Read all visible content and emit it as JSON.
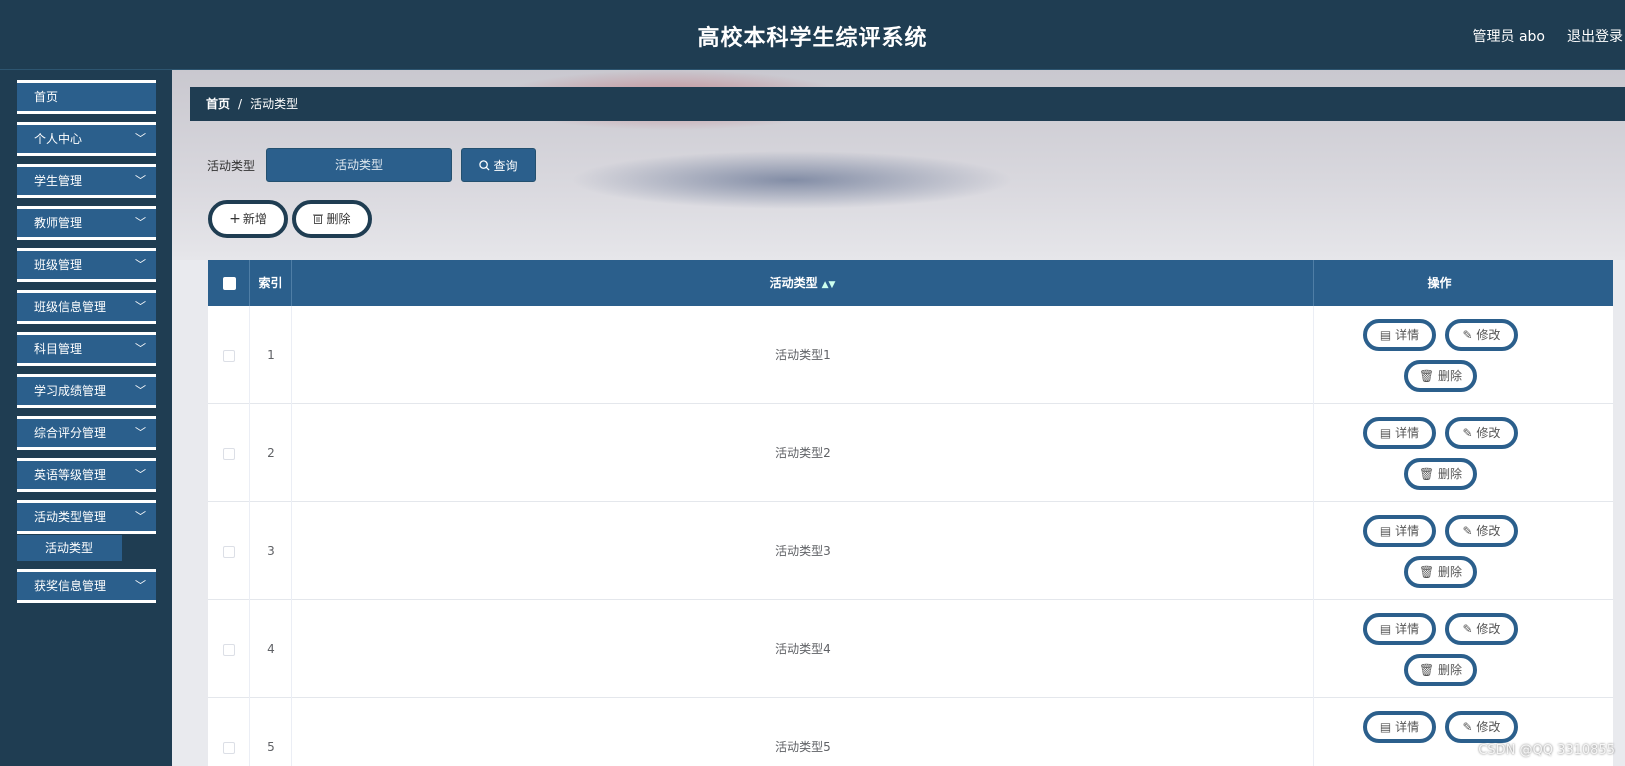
{
  "header": {
    "title": "高校本科学生综评系统",
    "user": "管理员 abo",
    "logout": "退出登录"
  },
  "sidebar": {
    "items": [
      {
        "label": "首页",
        "chevron": false
      },
      {
        "label": "个人中心",
        "chevron": true
      },
      {
        "label": "学生管理",
        "chevron": true
      },
      {
        "label": "教师管理",
        "chevron": true
      },
      {
        "label": "班级管理",
        "chevron": true
      },
      {
        "label": "班级信息管理",
        "chevron": true
      },
      {
        "label": "科目管理",
        "chevron": true
      },
      {
        "label": "学习成绩管理",
        "chevron": true
      },
      {
        "label": "综合评分管理",
        "chevron": true
      },
      {
        "label": "英语等级管理",
        "chevron": true
      },
      {
        "label": "活动类型管理",
        "chevron": true
      },
      {
        "label": "获奖信息管理",
        "chevron": true
      }
    ],
    "subitem": "活动类型",
    "chevron_glyph": "﹀"
  },
  "breadcrumb": {
    "home": "首页",
    "separator": "/",
    "current": "活动类型"
  },
  "filter": {
    "label": "活动类型",
    "placeholder": "活动类型",
    "search_button": "查询"
  },
  "actions": {
    "add": "新增",
    "delete": "删除"
  },
  "table": {
    "headers": {
      "index": "索引",
      "type": "活动类型",
      "ops": "操作"
    },
    "rows": [
      {
        "index": "1",
        "type": "活动类型1"
      },
      {
        "index": "2",
        "type": "活动类型2"
      },
      {
        "index": "3",
        "type": "活动类型3"
      },
      {
        "index": "4",
        "type": "活动类型4"
      },
      {
        "index": "5",
        "type": "活动类型5"
      }
    ],
    "row_buttons": {
      "detail": "详情",
      "edit": "修改",
      "delete": "删除"
    }
  },
  "watermark": "CSDN @QQ 3310855",
  "colors": {
    "header_bg": "#1f3d52",
    "accent": "#2b5f8c",
    "main_bg": "#e9eaee"
  }
}
